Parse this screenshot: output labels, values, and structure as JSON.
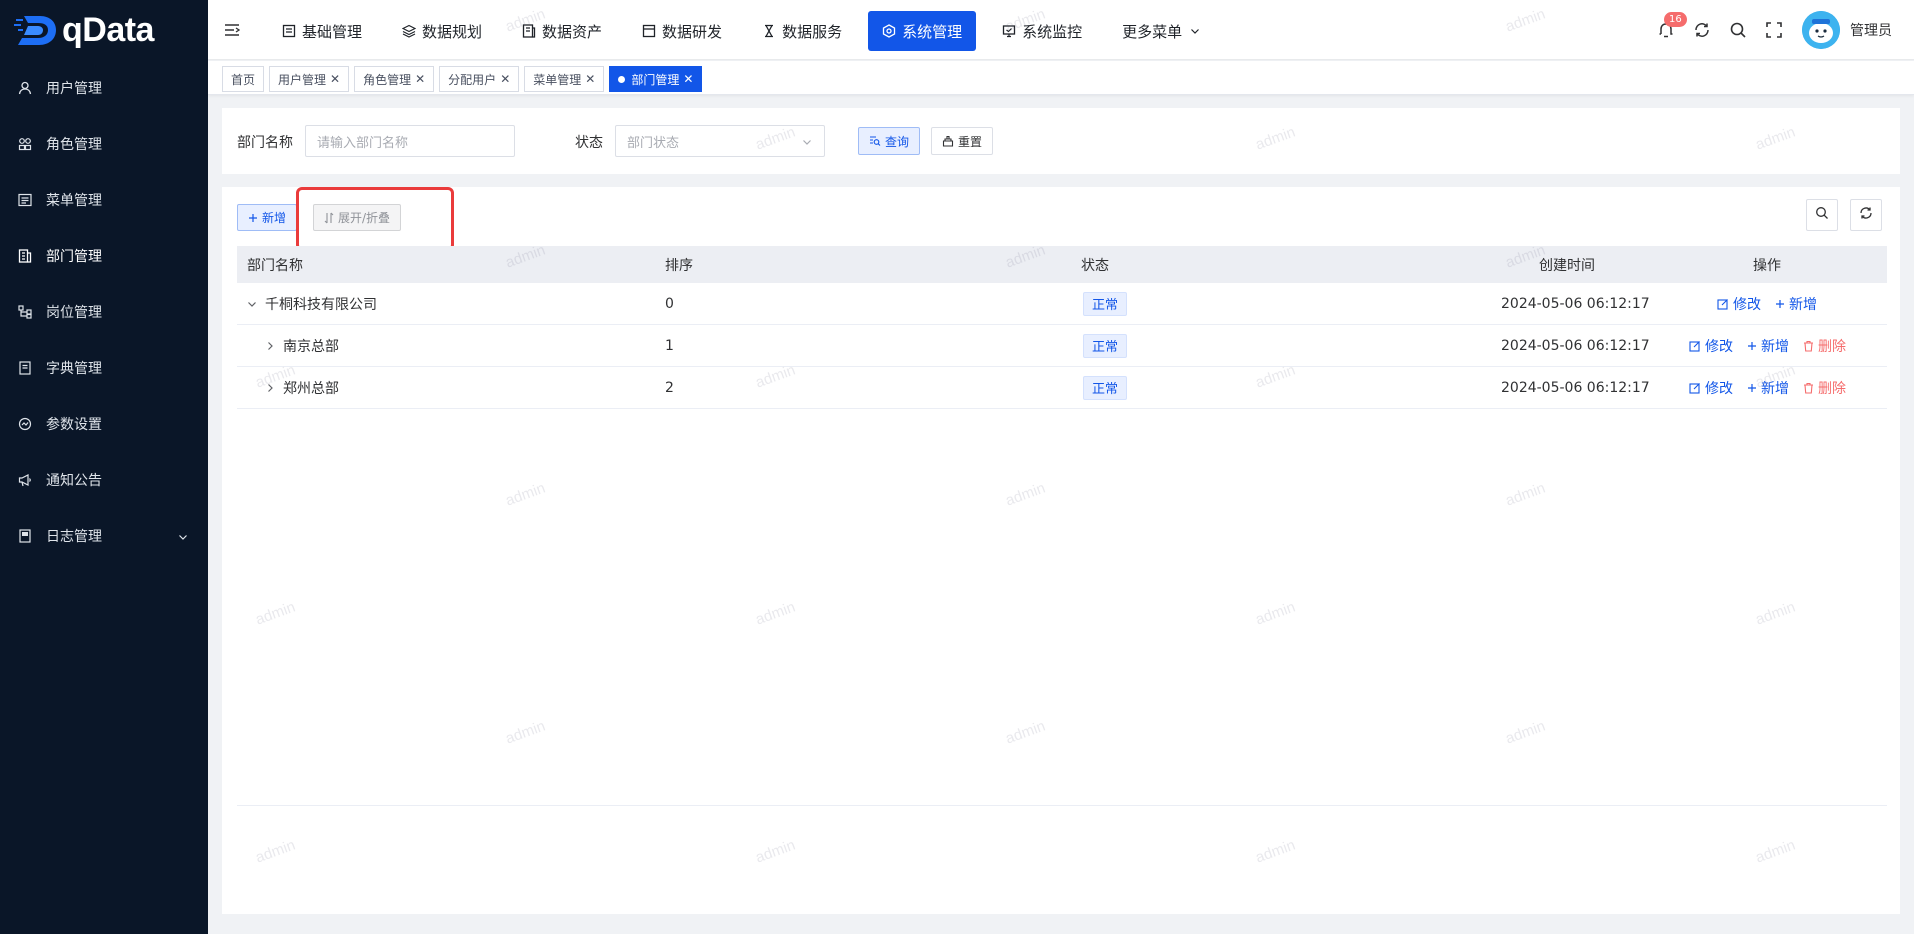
{
  "brand": {
    "name": "qData"
  },
  "sidebar": {
    "items": [
      {
        "label": "用户管理",
        "icon": "user-icon"
      },
      {
        "label": "角色管理",
        "icon": "role-icon"
      },
      {
        "label": "菜单管理",
        "icon": "menu-list-icon"
      },
      {
        "label": "部门管理",
        "icon": "department-icon",
        "active": true
      },
      {
        "label": "岗位管理",
        "icon": "post-icon"
      },
      {
        "label": "字典管理",
        "icon": "dictionary-icon"
      },
      {
        "label": "参数设置",
        "icon": "settings-icon"
      },
      {
        "label": "通知公告",
        "icon": "megaphone-icon"
      },
      {
        "label": "日志管理",
        "icon": "log-icon",
        "has_children": true
      }
    ]
  },
  "topnav": {
    "items": [
      {
        "label": "基础管理",
        "icon": "base-icon"
      },
      {
        "label": "数据规划",
        "icon": "layers-icon"
      },
      {
        "label": "数据资产",
        "icon": "asset-icon"
      },
      {
        "label": "数据研发",
        "icon": "dev-icon"
      },
      {
        "label": "数据服务",
        "icon": "hourglass-icon"
      },
      {
        "label": "系统管理",
        "icon": "system-icon",
        "active": true
      },
      {
        "label": "系统监控",
        "icon": "monitor-icon"
      },
      {
        "label": "更多菜单",
        "icon": "",
        "dropdown": true
      }
    ],
    "notification_count": "16",
    "username": "管理员"
  },
  "tags": [
    {
      "label": "首页",
      "closable": false
    },
    {
      "label": "用户管理",
      "closable": true
    },
    {
      "label": "角色管理",
      "closable": true
    },
    {
      "label": "分配用户",
      "closable": true
    },
    {
      "label": "菜单管理",
      "closable": true
    },
    {
      "label": "部门管理",
      "closable": true,
      "active": true
    }
  ],
  "search": {
    "dept_name_label": "部门名称",
    "dept_name_placeholder": "请输入部门名称",
    "status_label": "状态",
    "status_placeholder": "部门状态",
    "query_label": "查询",
    "reset_label": "重置"
  },
  "toolbar": {
    "add_label": "新增",
    "expand_label": "展开/折叠"
  },
  "table": {
    "columns": [
      "部门名称",
      "排序",
      "状态",
      "创建时间",
      "操作"
    ],
    "rows": [
      {
        "name": "千桐科技有限公司",
        "order": "0",
        "status": "正常",
        "created": "2024-05-06 06:12:17",
        "expanded": true,
        "ops": [
          "修改",
          "新增"
        ]
      },
      {
        "name": "南京总部",
        "order": "1",
        "status": "正常",
        "created": "2024-05-06 06:12:17",
        "expanded": false,
        "ops": [
          "修改",
          "新增",
          "删除"
        ]
      },
      {
        "name": "郑州总部",
        "order": "2",
        "status": "正常",
        "created": "2024-05-06 06:12:17",
        "expanded": false,
        "ops": [
          "修改",
          "新增",
          "删除"
        ]
      }
    ]
  },
  "watermark": {
    "text": "admin"
  },
  "colors": {
    "primary": "#1256e8",
    "sidebar_bg": "#0a1628",
    "danger": "#f56c6c",
    "highlight": "#ea3b3b"
  }
}
